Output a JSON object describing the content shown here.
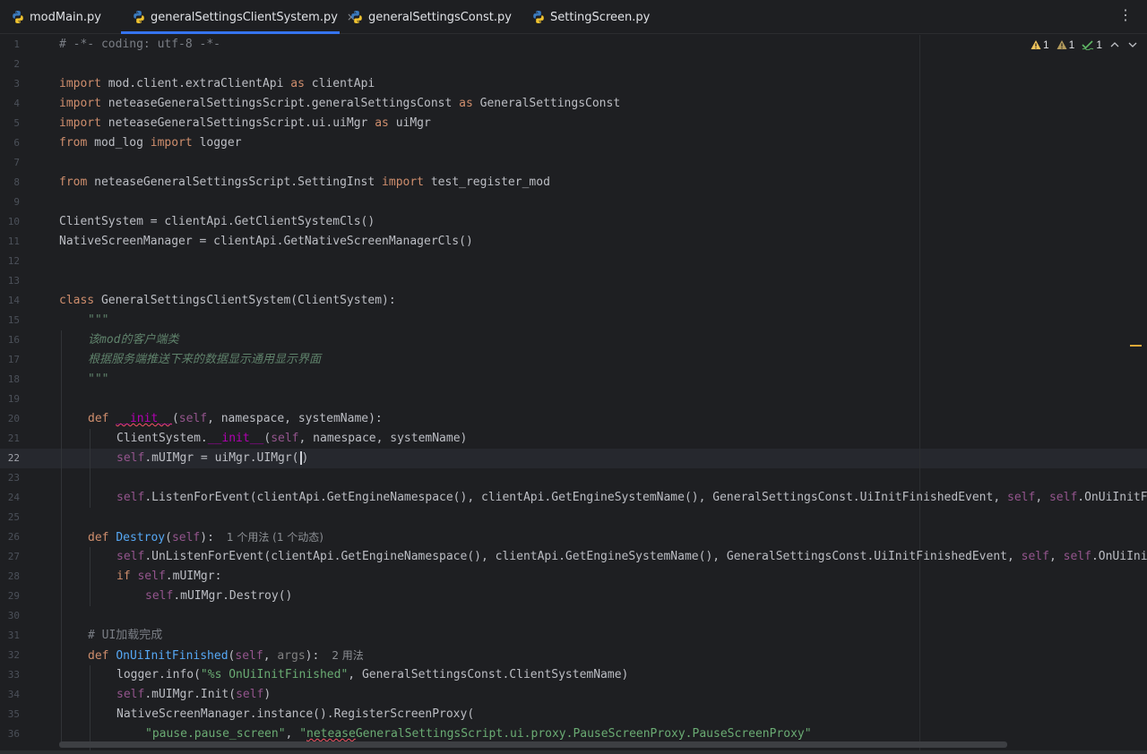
{
  "tabs": [
    {
      "label": "modMain.py",
      "active": false
    },
    {
      "label": "generalSettingsClientSystem.py",
      "active": true
    },
    {
      "label": "generalSettingsConst.py",
      "active": false
    },
    {
      "label": "SettingScreen.py",
      "active": false
    }
  ],
  "tab_close_glyph": "×",
  "more_menu_glyph": "⋮",
  "inspections": {
    "warning_count_1": "1",
    "weak_warning_count": "1",
    "typo_count": "1"
  },
  "current_line": 22,
  "line_numbers": [
    "1",
    "2",
    "3",
    "4",
    "5",
    "6",
    "7",
    "8",
    "9",
    "10",
    "11",
    "12",
    "13",
    "14",
    "15",
    "16",
    "17",
    "18",
    "19",
    "20",
    "21",
    "22",
    "23",
    "24",
    "25",
    "26",
    "27",
    "28",
    "29",
    "30",
    "31",
    "32",
    "33",
    "34",
    "35",
    "36"
  ],
  "code": {
    "l1": "# -*- coding: utf-8 -*-",
    "l3_module": "mod.client.extraClientApi",
    "l3_alias": "clientApi",
    "l4_module": "neteaseGeneralSettingsScript.generalSettingsConst",
    "l4_alias": "GeneralSettingsConst",
    "l5_module": "neteaseGeneralSettingsScript.ui.uiMgr",
    "l5_alias": "uiMgr",
    "l6_module": "mod_log",
    "l6_name": "logger",
    "l8_module": "neteaseGeneralSettingsScript.SettingInst",
    "l8_name": "test_register_mod",
    "l10": "ClientSystem = clientApi.GetClientSystemCls()",
    "l11": "NativeScreenManager = clientApi.GetNativeScreenManagerCls()",
    "l14_name": "GeneralSettingsClientSystem",
    "l14_rest": "(ClientSystem):",
    "l15": "\"\"\"",
    "l16": "该mod的客户端类",
    "l17": "根据服务端推送下来的数据显示通用显示界面",
    "l18": "\"\"\"",
    "l20_fn": "__init__",
    "l20_rest": ", namespace, systemName):",
    "l21_a": "ClientSystem.",
    "l21_fn": "__init__",
    "l21_rest": ", namespace, systemName)",
    "l22_rest": ".mUIMgr = uiMgr.UIMgr(",
    "l22_end": ")",
    "l24_a": ".ListenForEvent(clientApi.GetEngineNamespace(), clientApi.GetEngineSystemName(), GeneralSettingsConst.UiInitFinishedEvent, ",
    "l24_b": ".OnUiInitFinished)",
    "l26_fn": "Destroy",
    "l26_hint": "1 个用法 (1 个动态)",
    "l27_a": ".UnListenForEvent(clientApi.GetEngineNamespace(), clientApi.GetEngineSystemName(), GeneralSettingsConst.UiInitFinishedEvent, ",
    "l27_b": ".OnUiInitFinished)",
    "l28_rest": ".mUIMgr:",
    "l29_rest": ".mUIMgr.Destroy()",
    "l31": "# UI加载完成",
    "l32_fn": "OnUiInitFinished",
    "l32_param": "args",
    "l32_hint": "2 用法",
    "l33_a": "logger.info(",
    "l33_str": "\"%s OnUiInitFinished\"",
    "l33_b": ", GeneralSettingsConst.ClientSystemName)",
    "l34_a": ".mUIMgr.Init(",
    "l35": "NativeScreenManager.instance().RegisterScreenProxy(",
    "l36_s1": "\"pause.pause_screen\"",
    "l36_s2_a": "\"",
    "l36_s2_b": "netease",
    "l36_s2_c": "GeneralSettingsScript.ui.proxy.PauseScreenProxy.PauseScreenProxy\""
  },
  "keywords": {
    "import": "import",
    "as": "as",
    "from": "from",
    "class": "class",
    "def": "def",
    "if": "if",
    "self": "self"
  },
  "colors": {
    "keyword": "#cf8e6d",
    "function": "#56a8f5",
    "string": "#6aab73",
    "self": "#94558d",
    "comment": "#7a7e85",
    "docstring": "#5f826b",
    "background": "#1e1f22",
    "accent": "#3574f0"
  }
}
